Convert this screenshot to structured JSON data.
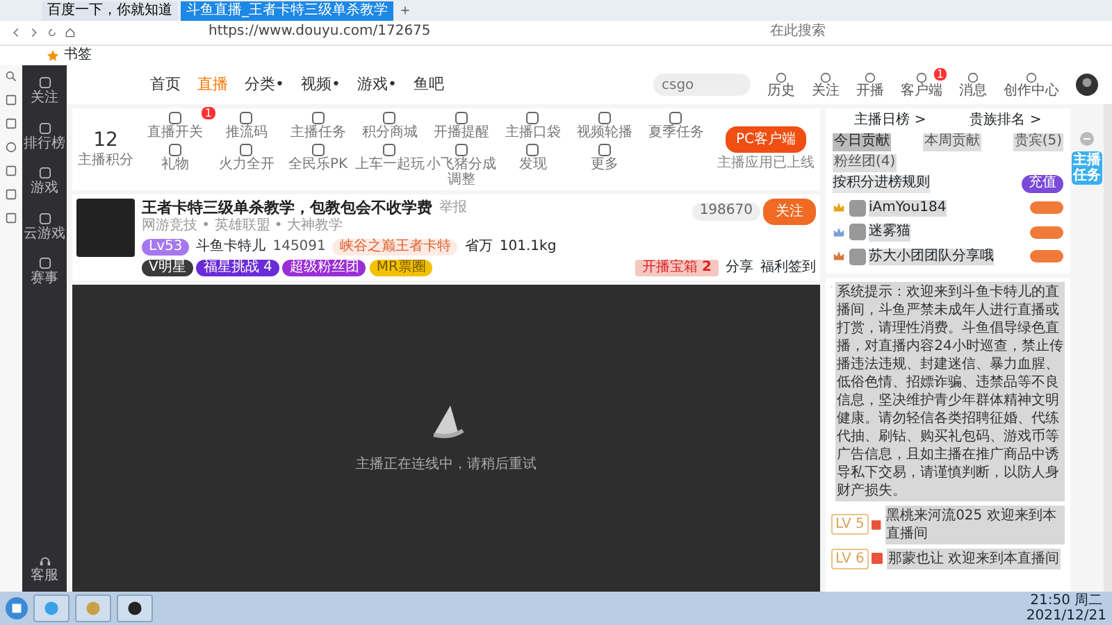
{
  "browser": {
    "tabs": [
      {
        "label": "百度一下，你就知道",
        "selected": false
      },
      {
        "label": "斗鱼直播_王者卡特三级单杀教学",
        "selected": true
      }
    ],
    "address": "https://www.douyu.com/172675",
    "search_placeholder": "在此搜索",
    "bookmarks": [
      "书签"
    ]
  },
  "header": {
    "nav": [
      {
        "label": "首页",
        "selected": false
      },
      {
        "label": "直播",
        "selected": true
      },
      {
        "label": "分类•",
        "selected": false
      },
      {
        "label": "视频•",
        "selected": false
      },
      {
        "label": "游戏•",
        "selected": false
      },
      {
        "label": "鱼吧",
        "selected": false
      }
    ],
    "search_placeholder": "csgo",
    "icons": [
      {
        "label": "历史"
      },
      {
        "label": "关注"
      },
      {
        "label": "开播"
      },
      {
        "label": "客户端",
        "badge": "1"
      },
      {
        "label": "消息"
      },
      {
        "label": "创作中心"
      }
    ]
  },
  "sidebar": [
    {
      "label": "关注"
    },
    {
      "label": "排行榜"
    },
    {
      "label": "游戏"
    },
    {
      "label": "云游戏"
    },
    {
      "label": "赛事"
    }
  ],
  "sidebar_bottom": "客服",
  "tools": {
    "score": "12",
    "score_label": "主播积分",
    "items": [
      {
        "label": "直播开关",
        "badge": "1"
      },
      {
        "label": "推流码"
      },
      {
        "label": "主播任务"
      },
      {
        "label": "积分商城"
      },
      {
        "label": "开播提醒"
      },
      {
        "label": "主播口袋"
      },
      {
        "label": "视频轮播"
      },
      {
        "label": "夏季任务"
      },
      {
        "label": "礼物"
      },
      {
        "label": "火力全开"
      },
      {
        "label": "全民乐PK"
      },
      {
        "label": "上车一起玩"
      },
      {
        "label": "小飞猪分成调整"
      },
      {
        "label": "发现"
      },
      {
        "label": "更多"
      }
    ],
    "pc_button": "PC客户端",
    "pc_note": "主播应用已上线"
  },
  "room": {
    "title": "王者卡特三级单杀教学，包教包会不收学费",
    "report": "举报",
    "category": "网游竞技 • 英雄联盟 • 大神教学",
    "level": "Lv53",
    "anchor": "斗鱼卡特儿",
    "heat": "145091",
    "honor": "峡谷之巅王者卡特",
    "city": "省万",
    "weight": "101.1kg",
    "followers": "198670",
    "follow": "关注",
    "badges": [
      {
        "label": "V明星",
        "color": "#3a3a3a"
      },
      {
        "label": "福星挑战 4",
        "color": "#6a2bd8"
      },
      {
        "label": "超级粉丝团",
        "color": "#9b2fd6"
      },
      {
        "label": "MR票圈",
        "color": "#f2c200"
      }
    ],
    "chest": "开播宝箱",
    "chest_count": "2",
    "share": "分享",
    "welfare": "福利签到"
  },
  "video": {
    "message": "主播正在连线中，请稍后重试"
  },
  "ranking": {
    "heads": [
      "主播日榜 >",
      "贵族排名 >"
    ],
    "tabs": [
      {
        "label": "今日贡献",
        "selected": true
      },
      {
        "label": "本周贡献",
        "selected": false
      },
      {
        "label": "贵宾(5)",
        "selected": false
      },
      {
        "label": "粉丝团(4)",
        "selected": false
      }
    ],
    "rule": "按积分进榜规则",
    "button": "充值",
    "rows": [
      {
        "name": "iAmYou184",
        "color": "#e8a317"
      },
      {
        "name": "迷雾猫",
        "color": "#7aa0d8"
      },
      {
        "name": "苏大小团团队分享哦",
        "color": "#d9773a"
      }
    ]
  },
  "chat": [
    {
      "kind": "system",
      "text": "系统提示：欢迎来到斗鱼卡特儿的直播间，斗鱼严禁未成年人进行直播或打赏，请理性消费。斗鱼倡导绿色直播，对直播内容24小时巡查，禁止传播违法违规、封建迷信、暴力血腥、低俗色情、招嫖诈骗、违禁品等不良信息，坚决维护青少年群体精神文明健康。请勿轻信各类招聘征婚、代练代抽、刷钻、购买礼包码、游戏币等广告信息，且如主播在推广商品中诱导私下交易，请谨慎判断，以防人身财产损失。"
    },
    {
      "kind": "user",
      "level": "LV 5",
      "text": "黑桃来河流025 欢迎来到本直播间"
    },
    {
      "kind": "user",
      "level": "LV 6",
      "text": "那蒙也让 欢迎来到本直播间"
    }
  ],
  "task_badge": "主播任务",
  "taskbar": {
    "time": "21:50 周二",
    "date": "2021/12/21"
  }
}
